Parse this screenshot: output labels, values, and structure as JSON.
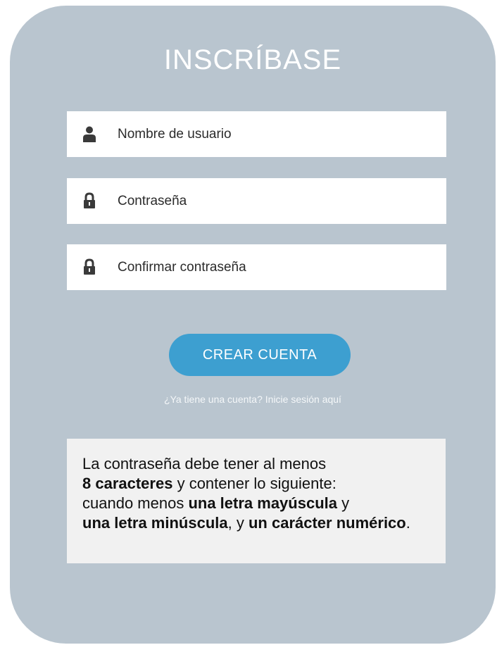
{
  "form": {
    "title": "INSCRÍBASE",
    "fields": [
      {
        "placeholder": "Nombre de usuario",
        "icon": "user-icon"
      },
      {
        "placeholder": "Contraseña",
        "icon": "lock-icon"
      },
      {
        "placeholder": "Confirmar contraseña",
        "icon": "lock-icon"
      }
    ],
    "submit_label": "CREAR CUENTA",
    "login_link": "¿Ya tiene una cuenta? Inicie sesión aquí"
  },
  "password_rules": {
    "line1": "La contraseña debe tener al menos",
    "min_chars": "8 caracteres",
    "line2": "y contener lo siguiente:",
    "line3": "cuando menos",
    "uppercase": "una letra mayúscula",
    "y1": "y",
    "lowercase": "una letra minúscula",
    "comma_y": ", y",
    "numeric": "un carácter numérico",
    "period": "."
  },
  "colors": {
    "card_bg": "#b9c5cf",
    "button_bg": "#3d9fd0",
    "field_bg": "#ffffff",
    "info_bg": "#f1f1f1"
  }
}
